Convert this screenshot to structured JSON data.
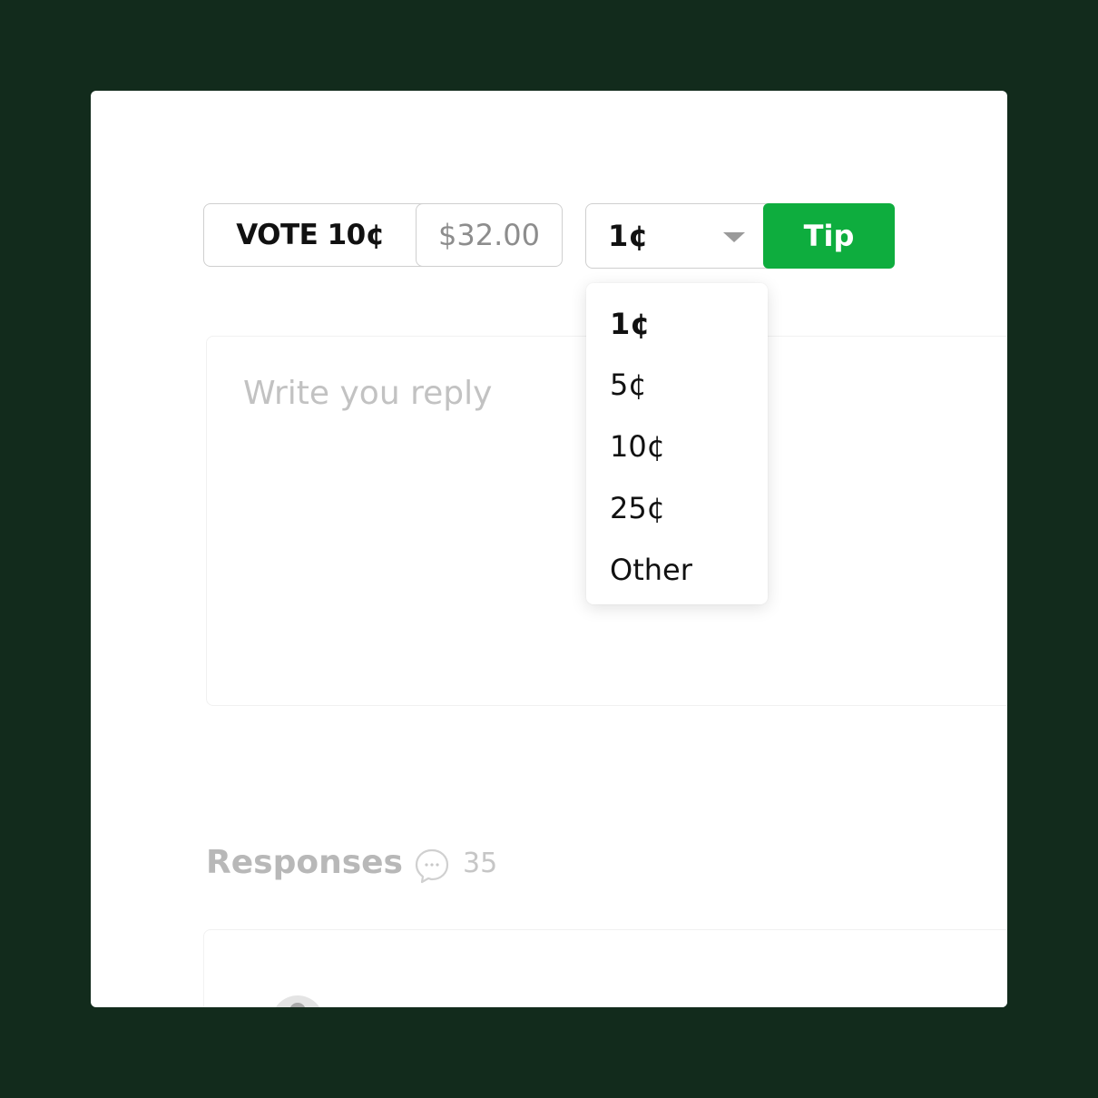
{
  "vote": {
    "label": "VOTE 10¢",
    "amount": "$32.00"
  },
  "tip": {
    "selected": "1¢",
    "button_label": "Tip",
    "options": [
      "1¢",
      "5¢",
      "10¢",
      "25¢",
      "Other"
    ]
  },
  "reply": {
    "placeholder": "Write you reply"
  },
  "responses": {
    "title": "Responses",
    "count": "35"
  },
  "colors": {
    "background": "#122b1c",
    "accent": "#0ead3e",
    "card": "#ffffff"
  },
  "icons": {
    "dropdown": "chevron-down-icon",
    "responses": "comment-icon",
    "avatar": "avatar"
  }
}
